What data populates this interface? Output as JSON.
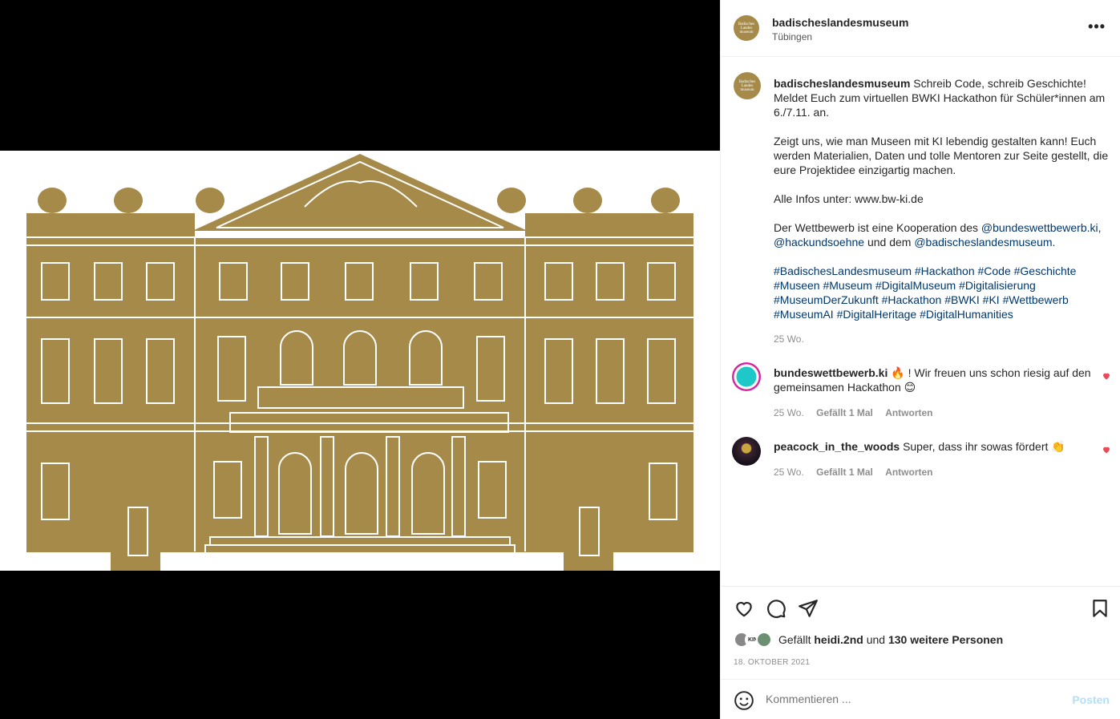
{
  "colors": {
    "gold": "#a58a4a",
    "link": "#00376b",
    "like_red": "#ed4956"
  },
  "header": {
    "username": "badischeslandesmuseum",
    "location": "Tübingen",
    "more": "•••",
    "avatar_text": [
      "Badisches",
      "Landes",
      "museum"
    ]
  },
  "caption": {
    "username": "badischeslandesmuseum",
    "p1": "Schreib Code, schreib Geschichte! Meldet Euch zum virtuellen BWKI Hackathon für Schüler*innen am 6./7.11. an.",
    "p2": "Zeigt uns, wie man Museen mit KI lebendig gestalten kann! Euch werden Materialien, Daten und tolle Mentoren zur Seite gestellt, die eure Projektidee einzigartig machen.",
    "p3": "Alle Infos unter: www.bw-ki.de",
    "p4_a": "Der Wettbewerb ist eine Kooperation des",
    "mention1": "@bundeswettbewerb.ki,",
    "mention2": "@hackundsoehne",
    "p4_b": "und dem",
    "mention3": "@badischeslandesmuseum.",
    "hashtags": "#BadischesLandesmuseum #Hackathon #Code #Geschichte #Museen #Museum #DigitalMuseum #Digitalisierung #MuseumDerZukunft #Hackathon #BWKI #KI #Wettbewerb #MuseumAI #DigitalHeritage #DigitalHumanities",
    "time": "25 Wo."
  },
  "comments": [
    {
      "username": "bundeswettbewerb.ki",
      "text": "🔥 ! Wir freuen uns schon riesig auf den gemeinsamen Hackathon 😊",
      "time": "25 Wo.",
      "likes": "Gefällt 1 Mal",
      "reply": "Antworten"
    },
    {
      "username": "peacock_in_the_woods",
      "text": "Super, dass ihr sowas fördert 👏",
      "time": "25 Wo.",
      "likes": "Gefällt 1 Mal",
      "reply": "Antworten"
    }
  ],
  "actions": {
    "icons": [
      "heart-icon",
      "comment-icon",
      "share-icon",
      "bookmark-icon"
    ],
    "likes_prefix": "Gefällt",
    "likes_user": "heidi.2nd",
    "likes_mid": "und",
    "likes_rest": "130 weitere Personen",
    "mini_avatar_text": "KIN",
    "date": "18. OKTOBER 2021"
  },
  "comment_box": {
    "placeholder": "Kommentieren ...",
    "post": "Posten"
  }
}
